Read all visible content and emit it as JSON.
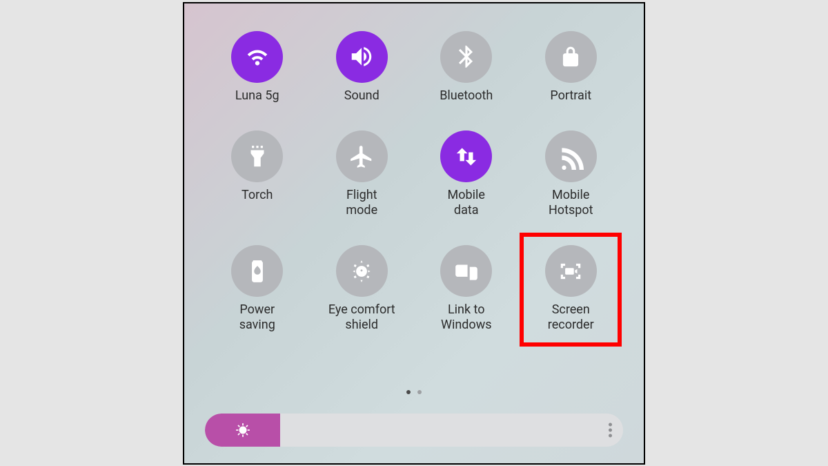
{
  "colors": {
    "active": "#8a2be2",
    "inactive": "#b5b7bb",
    "highlight": "#ff0000",
    "brightness_fill": "#b84fa8"
  },
  "tiles": [
    {
      "label": "Luna 5g",
      "icon": "wifi-icon",
      "active": true
    },
    {
      "label": "Sound",
      "icon": "sound-icon",
      "active": true
    },
    {
      "label": "Bluetooth",
      "icon": "bluetooth-icon",
      "active": false
    },
    {
      "label": "Portrait",
      "icon": "portrait-lock-icon",
      "active": false
    },
    {
      "label": "Torch",
      "icon": "torch-icon",
      "active": false
    },
    {
      "label": "Flight\nmode",
      "icon": "airplane-icon",
      "active": false
    },
    {
      "label": "Mobile\ndata",
      "icon": "mobile-data-icon",
      "active": true
    },
    {
      "label": "Mobile\nHotspot",
      "icon": "hotspot-icon",
      "active": false
    },
    {
      "label": "Power\nsaving",
      "icon": "power-saving-icon",
      "active": false
    },
    {
      "label": "Eye comfort\nshield",
      "icon": "eye-comfort-icon",
      "active": false
    },
    {
      "label": "Link to\nWindows",
      "icon": "link-windows-icon",
      "active": false
    },
    {
      "label": "Screen\nrecorder",
      "icon": "screen-recorder-icon",
      "active": false,
      "highlighted": true
    }
  ],
  "pagination": {
    "count": 2,
    "current": 0
  },
  "brightness": {
    "percent": 18
  }
}
